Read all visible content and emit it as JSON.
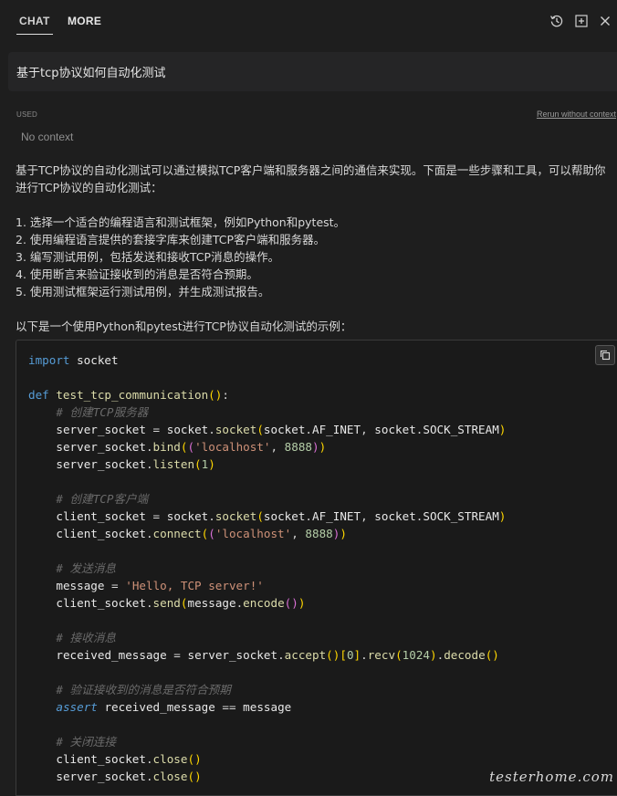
{
  "header": {
    "tabs": [
      {
        "label": "CHAT",
        "active": true
      },
      {
        "label": "MORE",
        "active": false
      }
    ],
    "actions": [
      "history-icon",
      "new-chat-icon",
      "close-icon"
    ]
  },
  "question": {
    "text": "基于tcp协议如何自动化测试"
  },
  "context": {
    "used_label": "USED",
    "rerun_label": "Rerun without context",
    "no_context": "No context"
  },
  "answer": {
    "intro": "基于TCP协议的自动化测试可以通过模拟TCP客户端和服务器之间的通信来实现。下面是一些步骤和工具，可以帮助你进行TCP协议的自动化测试：",
    "steps": [
      "1. 选择一个适合的编程语言和测试框架，例如Python和pytest。",
      "2. 使用编程语言提供的套接字库来创建TCP客户端和服务器。",
      "3. 编写测试用例，包括发送和接收TCP消息的操作。",
      "4. 使用断言来验证接收到的消息是否符合预期。",
      "5. 使用测试框架运行测试用例，并生成测试报告。"
    ],
    "example_intro": "以下是一个使用Python和pytest进行TCP协议自动化测试的示例："
  },
  "code": {
    "language": "python",
    "lines": [
      "import socket",
      "",
      "def test_tcp_communication():",
      "    # 创建TCP服务器",
      "    server_socket = socket.socket(socket.AF_INET, socket.SOCK_STREAM)",
      "    server_socket.bind(('localhost', 8888))",
      "    server_socket.listen(1)",
      "",
      "    # 创建TCP客户端",
      "    client_socket = socket.socket(socket.AF_INET, socket.SOCK_STREAM)",
      "    client_socket.connect(('localhost', 8888))",
      "",
      "    # 发送消息",
      "    message = 'Hello, TCP server!'",
      "    client_socket.send(message.encode())",
      "",
      "    # 接收消息",
      "    received_message = server_socket.accept()[0].recv(1024).decode()",
      "",
      "    # 验证接收到的消息是否符合预期",
      "    assert received_message == message",
      "",
      "    # 关闭连接",
      "    client_socket.close()",
      "    server_socket.close()"
    ],
    "copy_icon": "copy-icon"
  },
  "watermark": {
    "text": "testerhome.com"
  }
}
